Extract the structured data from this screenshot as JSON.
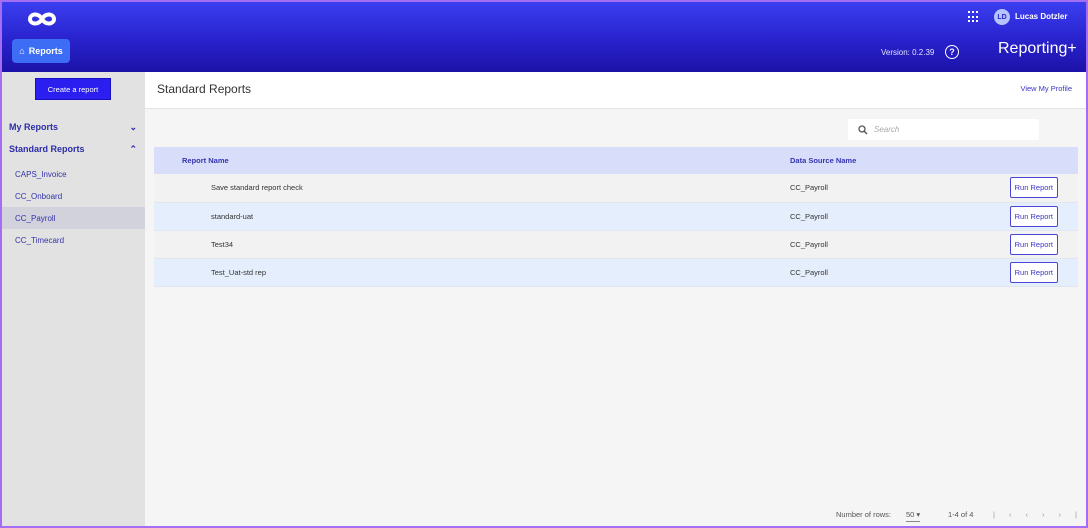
{
  "header": {
    "nav_reports": "Reports",
    "user_initials": "LD",
    "user_name": "Lucas Dotzler",
    "version": "Version: 0.2.39",
    "help": "?",
    "brand": "Reporting+"
  },
  "sidebar": {
    "create": "Create a report",
    "my_reports": "My Reports",
    "standard_reports": "Standard Reports",
    "items": [
      "CAPS_Invoice",
      "CC_Onboard",
      "CC_Payroll",
      "CC_Timecard"
    ]
  },
  "main": {
    "title": "Standard Reports",
    "view_profile": "View My Profile",
    "search_placeholder": "Search",
    "columns": [
      "Report Name",
      "Data Source Name"
    ],
    "rows": [
      {
        "name": "Save standard report check",
        "source": "CC_Payroll",
        "action": "Run Report"
      },
      {
        "name": "standard-uat",
        "source": "CC_Payroll",
        "action": "Run Report"
      },
      {
        "name": "Test34",
        "source": "CC_Payroll",
        "action": "Run Report"
      },
      {
        "name": "Test_Uat-std rep",
        "source": "CC_Payroll",
        "action": "Run Report"
      }
    ]
  },
  "footer": {
    "rows_label": "Number of rows:",
    "rows_value": "50",
    "range": "1-4 of 4"
  }
}
